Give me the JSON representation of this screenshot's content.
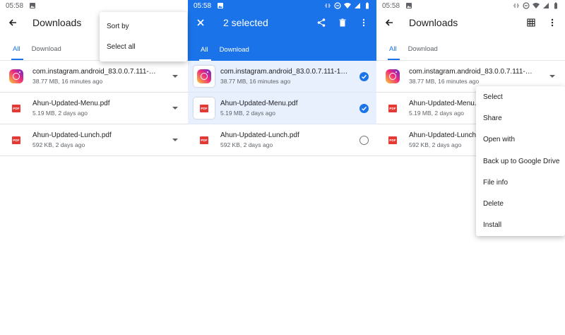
{
  "status_time": "05:58",
  "app_title": "Downloads",
  "tabs": [
    "All",
    "Download"
  ],
  "files": [
    {
      "name": "com.instagram.android_83.0.0.7.111-…",
      "meta": "38.77 MB, 16 minutes ago",
      "icon": "instagram-icon"
    },
    {
      "name": "Ahun-Updated-Menu.pdf",
      "meta": "5.19 MB, 2 days ago",
      "icon": "pdf-icon"
    },
    {
      "name": "Ahun-Updated-Lunch.pdf",
      "meta": "592 KB, 2 days ago",
      "icon": "pdf-icon"
    }
  ],
  "selection_files": [
    {
      "name": "com.instagram.android_83.0.0.7.111-14…"
    },
    {
      "name": "Ahun-Updated-Menu.pdf"
    },
    {
      "name": "Ahun-Updated-Lunch.pdf"
    }
  ],
  "pdf_badge": "PDF",
  "overflow_menu": {
    "sort_by": "Sort by",
    "select_all": "Select all"
  },
  "selection": {
    "count_label": "2 selected"
  },
  "context_menu": {
    "items": [
      "Select",
      "Share",
      "Open with",
      "Back up to Google Drive",
      "File info",
      "Delete",
      "Install"
    ]
  },
  "colors": {
    "accent": "#1a73e8",
    "selected_row": "#e8f0fe",
    "pdf": "#e53935"
  }
}
